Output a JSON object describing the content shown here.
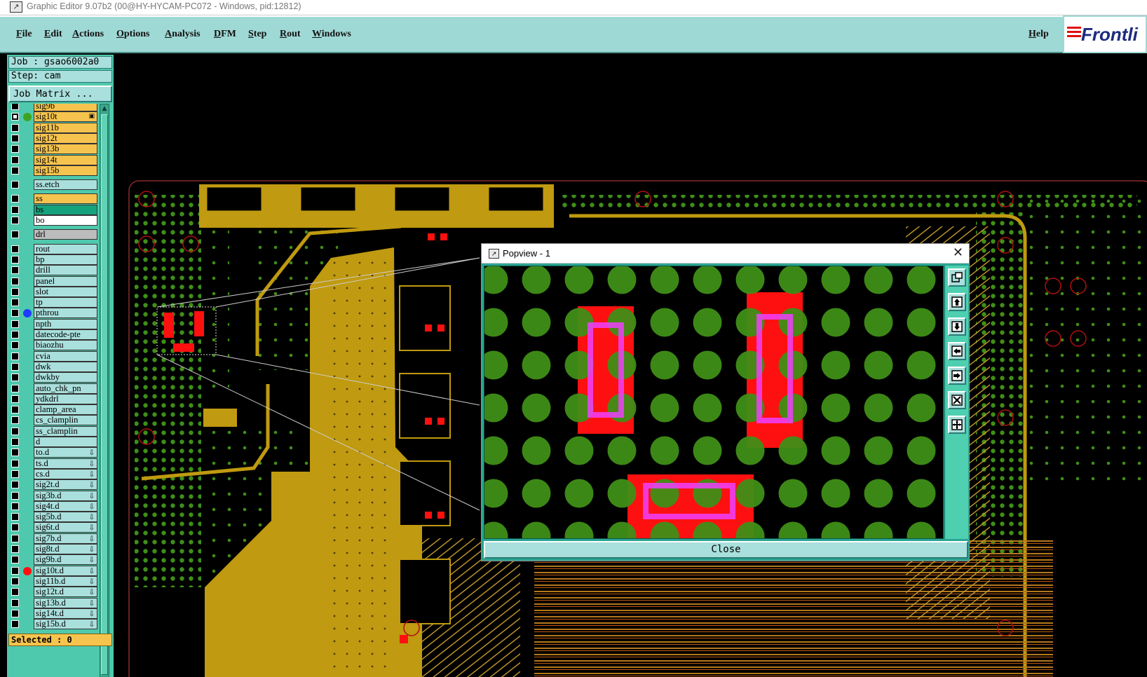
{
  "window": {
    "title": "Graphic Editor 9.07b2 (00@HY-HYCAM-PC072 - Windows, pid:12812)",
    "icon": "app-icon"
  },
  "menu": {
    "items": [
      "File",
      "Edit",
      "Actions",
      "Options",
      "Analysis",
      "DFM",
      "Step",
      "Rout",
      "Windows"
    ],
    "help": "Help",
    "logo": "Frontli"
  },
  "job": {
    "job_line": "Job : gsao6002a0",
    "step_line": "Step: cam",
    "matrix_button": "Job Matrix ..."
  },
  "layers": [
    {
      "name": "sig9b",
      "style": "gold",
      "dot": "",
      "checked": false
    },
    {
      "name": "sig10t",
      "style": "gold",
      "dot": "#3ea320",
      "checked": true,
      "mark": "box"
    },
    {
      "name": "sig11b",
      "style": "gold",
      "dot": "",
      "checked": false
    },
    {
      "name": "sig12t",
      "style": "gold",
      "dot": "",
      "checked": false
    },
    {
      "name": "sig13b",
      "style": "gold",
      "dot": "",
      "checked": false
    },
    {
      "name": "sig14t",
      "style": "gold",
      "dot": "",
      "checked": false
    },
    {
      "name": "sig15b",
      "style": "gold",
      "dot": "",
      "checked": false
    },
    {
      "name": "ss.etch",
      "style": "cyan",
      "dot": "",
      "checked": false,
      "gap": true
    },
    {
      "name": "ss",
      "style": "gold",
      "dot": "",
      "checked": false,
      "gap": true
    },
    {
      "name": "bs",
      "style": "teal",
      "dot": "",
      "checked": false
    },
    {
      "name": "bo",
      "style": "white",
      "dot": "",
      "checked": false
    },
    {
      "name": "drl",
      "style": "gray",
      "dot": "",
      "checked": false,
      "gap": true
    },
    {
      "name": "rout",
      "style": "cyan",
      "dot": "",
      "checked": false,
      "gap": true
    },
    {
      "name": "bp",
      "style": "cyan",
      "dot": "",
      "checked": false
    },
    {
      "name": "drill",
      "style": "cyan",
      "dot": "",
      "checked": false
    },
    {
      "name": "panel",
      "style": "cyan",
      "dot": "",
      "checked": false
    },
    {
      "name": "slot",
      "style": "cyan",
      "dot": "",
      "checked": false
    },
    {
      "name": "tp",
      "style": "cyan",
      "dot": "",
      "checked": false
    },
    {
      "name": "pthrou",
      "style": "cyan",
      "dot": "#1f3cff",
      "checked": false
    },
    {
      "name": "npth",
      "style": "cyan",
      "dot": "",
      "checked": false
    },
    {
      "name": "datecode-pte",
      "style": "cyan",
      "dot": "",
      "checked": false
    },
    {
      "name": "biaozhu",
      "style": "cyan",
      "dot": "",
      "checked": false
    },
    {
      "name": "cvia",
      "style": "cyan",
      "dot": "",
      "checked": false
    },
    {
      "name": "dwk",
      "style": "cyan",
      "dot": "",
      "checked": false
    },
    {
      "name": "dwkby",
      "style": "cyan",
      "dot": "",
      "checked": false
    },
    {
      "name": "auto_chk_pn",
      "style": "cyan",
      "dot": "",
      "checked": false
    },
    {
      "name": "ydkdrl",
      "style": "cyan",
      "dot": "",
      "checked": false
    },
    {
      "name": "clamp_area",
      "style": "cyan",
      "dot": "",
      "checked": false
    },
    {
      "name": "cs_clamplin",
      "style": "cyan",
      "dot": "",
      "checked": false
    },
    {
      "name": "ss_clamplin",
      "style": "cyan",
      "dot": "",
      "checked": false
    },
    {
      "name": "d",
      "style": "cyan",
      "dot": "",
      "checked": false
    },
    {
      "name": "to.d",
      "style": "cyan",
      "dot": "",
      "checked": false,
      "mark": "arrow"
    },
    {
      "name": "ts.d",
      "style": "cyan",
      "dot": "",
      "checked": false,
      "mark": "arrow"
    },
    {
      "name": "cs.d",
      "style": "cyan",
      "dot": "",
      "checked": false,
      "mark": "arrow"
    },
    {
      "name": "sig2t.d",
      "style": "cyan",
      "dot": "",
      "checked": false,
      "mark": "arrow"
    },
    {
      "name": "sig3b.d",
      "style": "cyan",
      "dot": "",
      "checked": false,
      "mark": "arrow"
    },
    {
      "name": "sig4t.d",
      "style": "cyan",
      "dot": "",
      "checked": false,
      "mark": "arrow"
    },
    {
      "name": "sig5b.d",
      "style": "cyan",
      "dot": "",
      "checked": false,
      "mark": "arrow"
    },
    {
      "name": "sig6t.d",
      "style": "cyan",
      "dot": "",
      "checked": false,
      "mark": "arrow"
    },
    {
      "name": "sig7b.d",
      "style": "cyan",
      "dot": "",
      "checked": false,
      "mark": "arrow"
    },
    {
      "name": "sig8t.d",
      "style": "cyan",
      "dot": "",
      "checked": false,
      "mark": "arrow"
    },
    {
      "name": "sig9b.d",
      "style": "cyan",
      "dot": "",
      "checked": false,
      "mark": "arrow"
    },
    {
      "name": "sig10t.d",
      "style": "cyan",
      "dot": "#ff1010",
      "checked": false,
      "mark": "arrow"
    },
    {
      "name": "sig11b.d",
      "style": "cyan",
      "dot": "",
      "checked": false,
      "mark": "arrow"
    },
    {
      "name": "sig12t.d",
      "style": "cyan",
      "dot": "",
      "checked": false,
      "mark": "arrow"
    },
    {
      "name": "sig13b.d",
      "style": "cyan",
      "dot": "",
      "checked": false,
      "mark": "arrow"
    },
    {
      "name": "sig14t.d",
      "style": "cyan",
      "dot": "",
      "checked": false,
      "mark": "arrow"
    },
    {
      "name": "sig15b.d",
      "style": "cyan",
      "dot": "",
      "checked": false,
      "mark": "arrow"
    }
  ],
  "status": {
    "selected": "Selected : 0"
  },
  "popview": {
    "title": "Popview - 1",
    "close_label": "Close",
    "tools": [
      "zoom-window-icon",
      "pan-up-icon",
      "pan-down-icon",
      "pan-left-icon",
      "pan-right-icon",
      "zoom-home-icon",
      "zoom-fit-icon"
    ]
  },
  "colors": {
    "copper": "#c09a10",
    "via": "#3f8f17",
    "pad": "#ff1010",
    "highlight": "#f040ff",
    "panel": "#9fd9d5",
    "accent_teal": "#4fc9ad"
  }
}
